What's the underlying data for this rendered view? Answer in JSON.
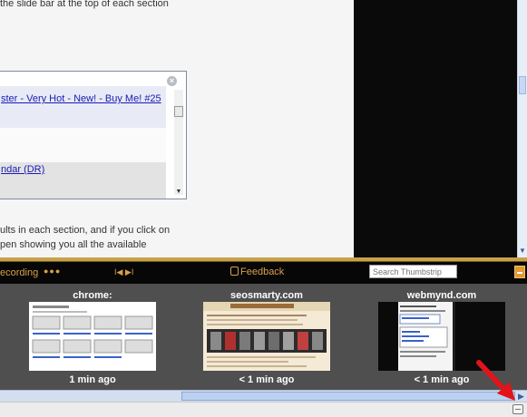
{
  "page": {
    "lines": [
      "the slide bar at the top of each section",
      "ults in each section, and if you click on",
      "pen showing you all the available"
    ],
    "popup": {
      "link1": "ster - Very Hot - New! - Buy Me! #25",
      "link2": "ndar (DR)",
      "close_icon": "close-circle-icon"
    }
  },
  "toolbar": {
    "recording_label": "ecording",
    "dots": "●●●",
    "prev_icon": "⏮",
    "next_icon": "⏭",
    "nav_text": "I◀  ▶I",
    "feedback_label": "Feedback",
    "search_placeholder": "Search Thumbstrip"
  },
  "thumbnails": [
    {
      "title": "chrome:",
      "time": "1 min ago"
    },
    {
      "title": "seosmarty.com",
      "time": "< 1 min ago"
    },
    {
      "title": "webmynd.com",
      "time": "< 1 min ago"
    }
  ],
  "colors": {
    "accent_orange": "#d9a04a",
    "strip_bg": "#4f4f4f",
    "arrow_red": "#e0141a"
  }
}
